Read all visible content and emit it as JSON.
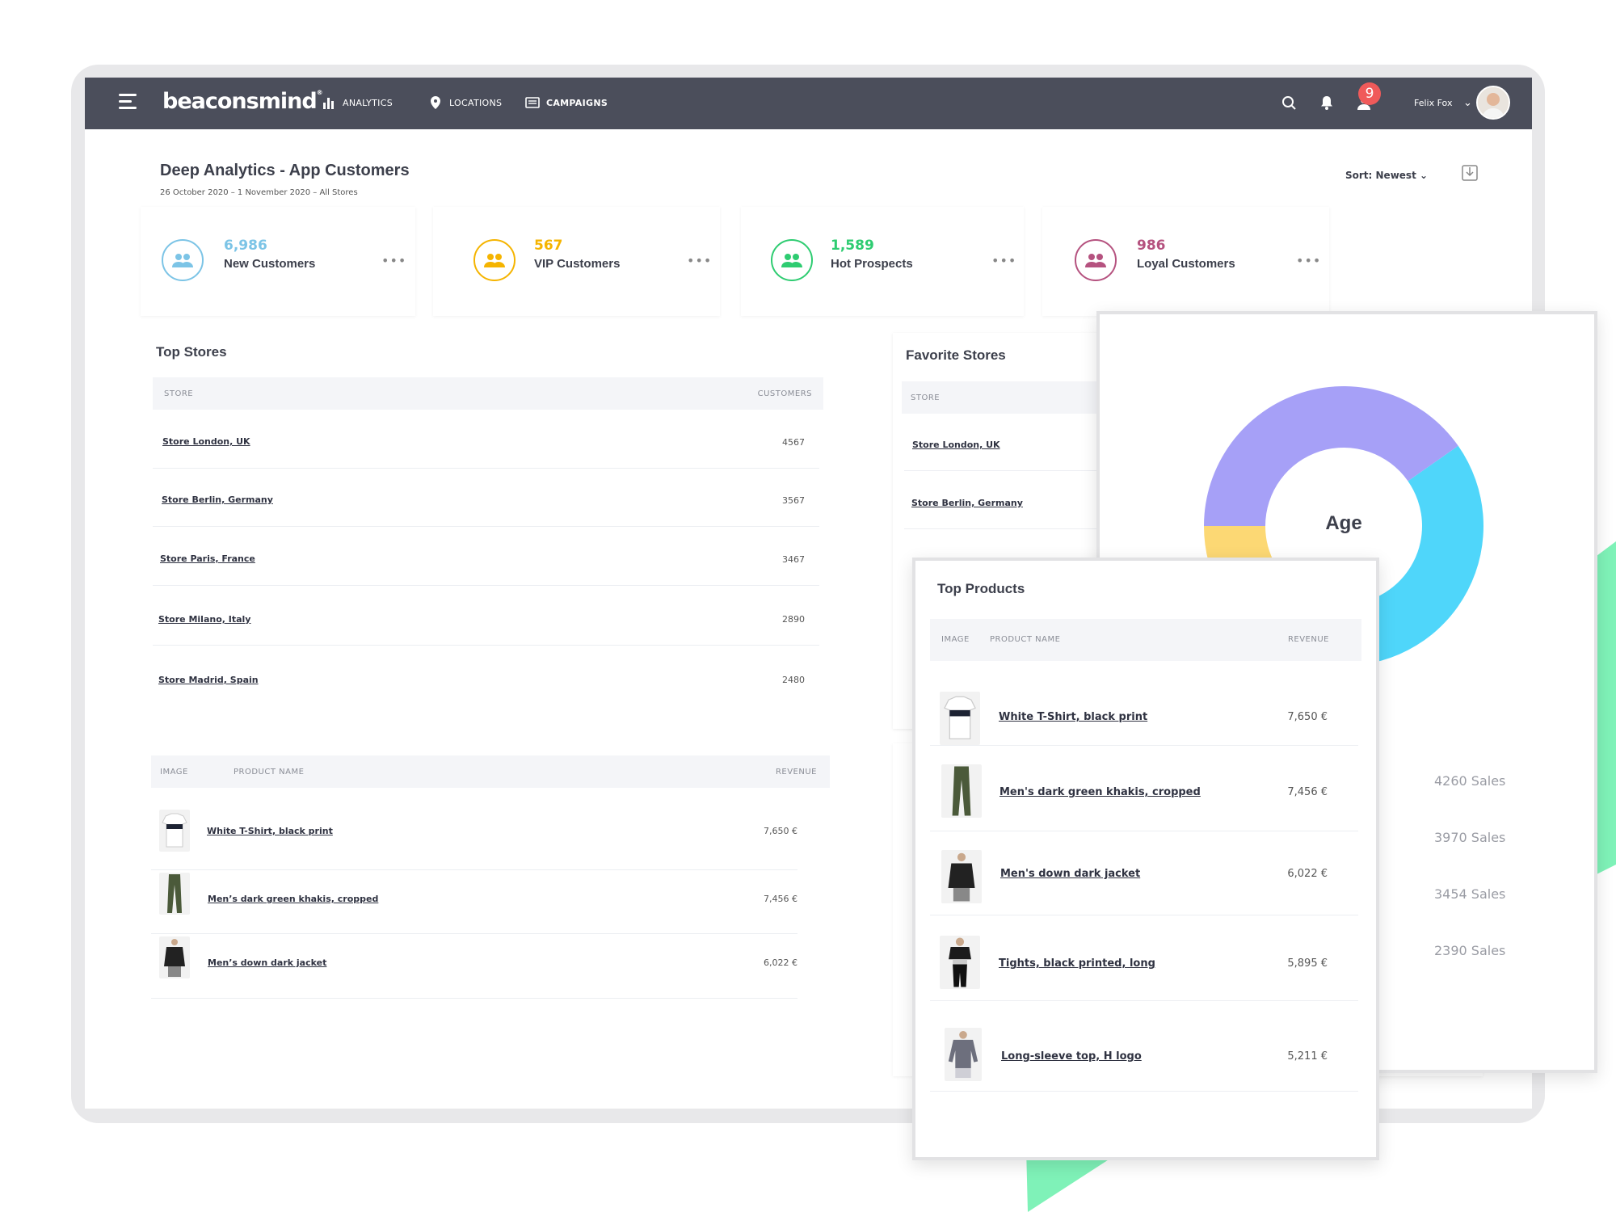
{
  "nav": {
    "logo": "beaconsmind",
    "items": [
      {
        "label": "ANALYTICS",
        "icon": "bar-chart-icon"
      },
      {
        "label": "LOCATIONS",
        "icon": "location-pin-icon"
      },
      {
        "label": "CAMPAIGNS",
        "icon": "campaigns-icon"
      }
    ],
    "notification_count": "9",
    "user_name": "Felix Fox"
  },
  "page": {
    "title": "Deep Analytics - App Customers",
    "subtitle": "26 October 2020 – 1 November 2020 – All Stores",
    "sort_label": "Sort: Newest"
  },
  "stats": [
    {
      "value": "6,986",
      "label": "New Customers",
      "color": "#7cc4e6"
    },
    {
      "value": "567",
      "label": "VIP Customers",
      "color": "#f5b400"
    },
    {
      "value": "1,589",
      "label": "Hot Prospects",
      "color": "#2ecc71"
    },
    {
      "value": "986",
      "label": "Loyal Customers",
      "color": "#b5527f"
    }
  ],
  "top_stores": {
    "title": "Top Stores",
    "col_store": "STORE",
    "col_customers": "CUSTOMERS",
    "rows": [
      {
        "store": "Store London, UK",
        "customers": "4567"
      },
      {
        "store": "Store Berlin, Germany",
        "customers": "3567"
      },
      {
        "store": "Store Paris, France",
        "customers": "3467"
      },
      {
        "store": "Store Milano, Italy",
        "customers": "2890"
      },
      {
        "store": "Store Madrid, Spain",
        "customers": "2480"
      }
    ]
  },
  "products_table": {
    "col_image": "IMAGE",
    "col_name": "PRODUCT NAME",
    "col_revenue": "REVENUE",
    "rows": [
      {
        "name": "White T-Shirt, black print",
        "revenue": "7,650 €"
      },
      {
        "name": "Men’s dark green khakis, cropped",
        "revenue": "7,456 €"
      },
      {
        "name": "Men’s down dark jacket",
        "revenue": "6,022 €"
      }
    ]
  },
  "favorite_stores": {
    "title": "Favorite Stores",
    "col_store": "STORE",
    "rows": [
      "Store London, UK",
      "Store Berlin, Germany"
    ]
  },
  "age_chart": {
    "center_label": "Age",
    "colors": [
      "#4fd6fa",
      "#ff8068",
      "#fcd874",
      "#a6a0f7"
    ],
    "sales": [
      "4260 Sales",
      "3970 Sales",
      "3454 Sales",
      "2390 Sales"
    ]
  },
  "top_products": {
    "title": "Top Products",
    "col_image": "IMAGE",
    "col_name": "PRODUCT NAME",
    "col_revenue": "REVENUE",
    "rows": [
      {
        "name": "White T-Shirt, black print",
        "revenue": "7,650 €"
      },
      {
        "name": "Men's dark green khakis, cropped",
        "revenue": "7,456 €"
      },
      {
        "name": "Men's down dark jacket",
        "revenue": "6,022 €"
      },
      {
        "name": "Tights, black printed, long",
        "revenue": "5,895 €"
      },
      {
        "name": "Long-sleeve top, H logo",
        "revenue": "5,211 €"
      }
    ]
  }
}
